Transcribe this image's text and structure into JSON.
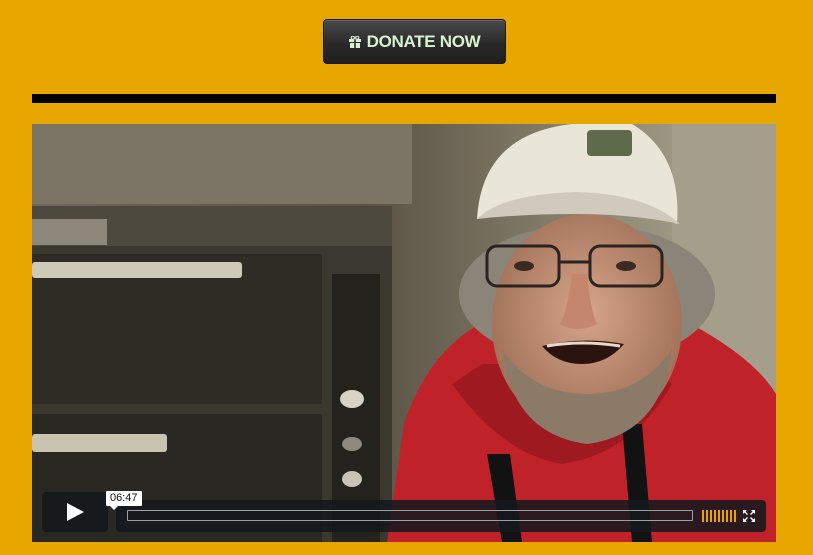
{
  "donate": {
    "label": "DONATE NOW",
    "icon": "gift-icon"
  },
  "video": {
    "current_time": "06:47",
    "volume_level": 1.0,
    "icons": {
      "play": "play-icon",
      "volume": "volume-bars-icon",
      "fullscreen": "fullscreen-icon"
    }
  },
  "colors": {
    "page_background": "#E8A600",
    "divider": "#000000",
    "button_text": "#d9f3d0",
    "volume_accent": "#f0a000"
  }
}
